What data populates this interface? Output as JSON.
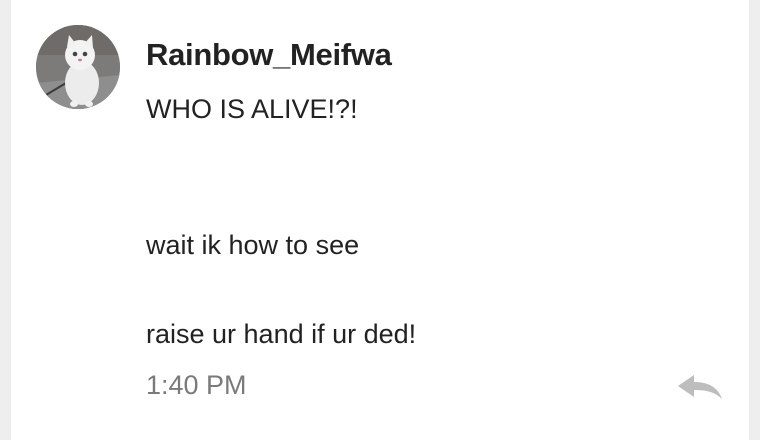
{
  "post": {
    "username": "Rainbow_Meifwa",
    "lines": [
      "WHO IS ALIVE!?!",
      "wait ik how to see",
      "raise ur hand if ur ded!"
    ],
    "timestamp": "1:40 PM",
    "avatar_icon": "avatar-white-cat",
    "reply_icon": "reply-arrow-icon"
  },
  "colors": {
    "background": "#eeeeee",
    "card": "#ffffff",
    "text": "#222222",
    "timestamp": "#7a7a7a",
    "reply_icon": "#bdbdbd"
  }
}
